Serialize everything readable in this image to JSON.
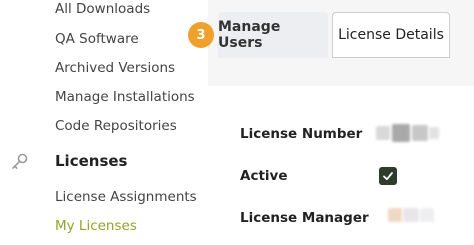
{
  "nav": {
    "items": [
      {
        "label": "All Downloads"
      },
      {
        "label": "QA Software"
      },
      {
        "label": "Archived Versions"
      },
      {
        "label": "Manage Installations"
      },
      {
        "label": "Code Repositories"
      }
    ],
    "section": {
      "label": "Licenses",
      "icon": "key-icon"
    },
    "sub_items": [
      {
        "label": "License Assignments"
      },
      {
        "label": "My Licenses",
        "active": true
      }
    ]
  },
  "tabs": {
    "step_number": "3",
    "manage_users_label": "Manage Users",
    "license_details_label": "License Details"
  },
  "details": {
    "license_number_label": "License Number",
    "active_label": "Active",
    "active_checked": true,
    "license_manager_label": "License Manager"
  },
  "colors": {
    "accent_green": "#93a32a",
    "step_badge": "#f0a02c",
    "checkbox": "#2f3b2b"
  }
}
